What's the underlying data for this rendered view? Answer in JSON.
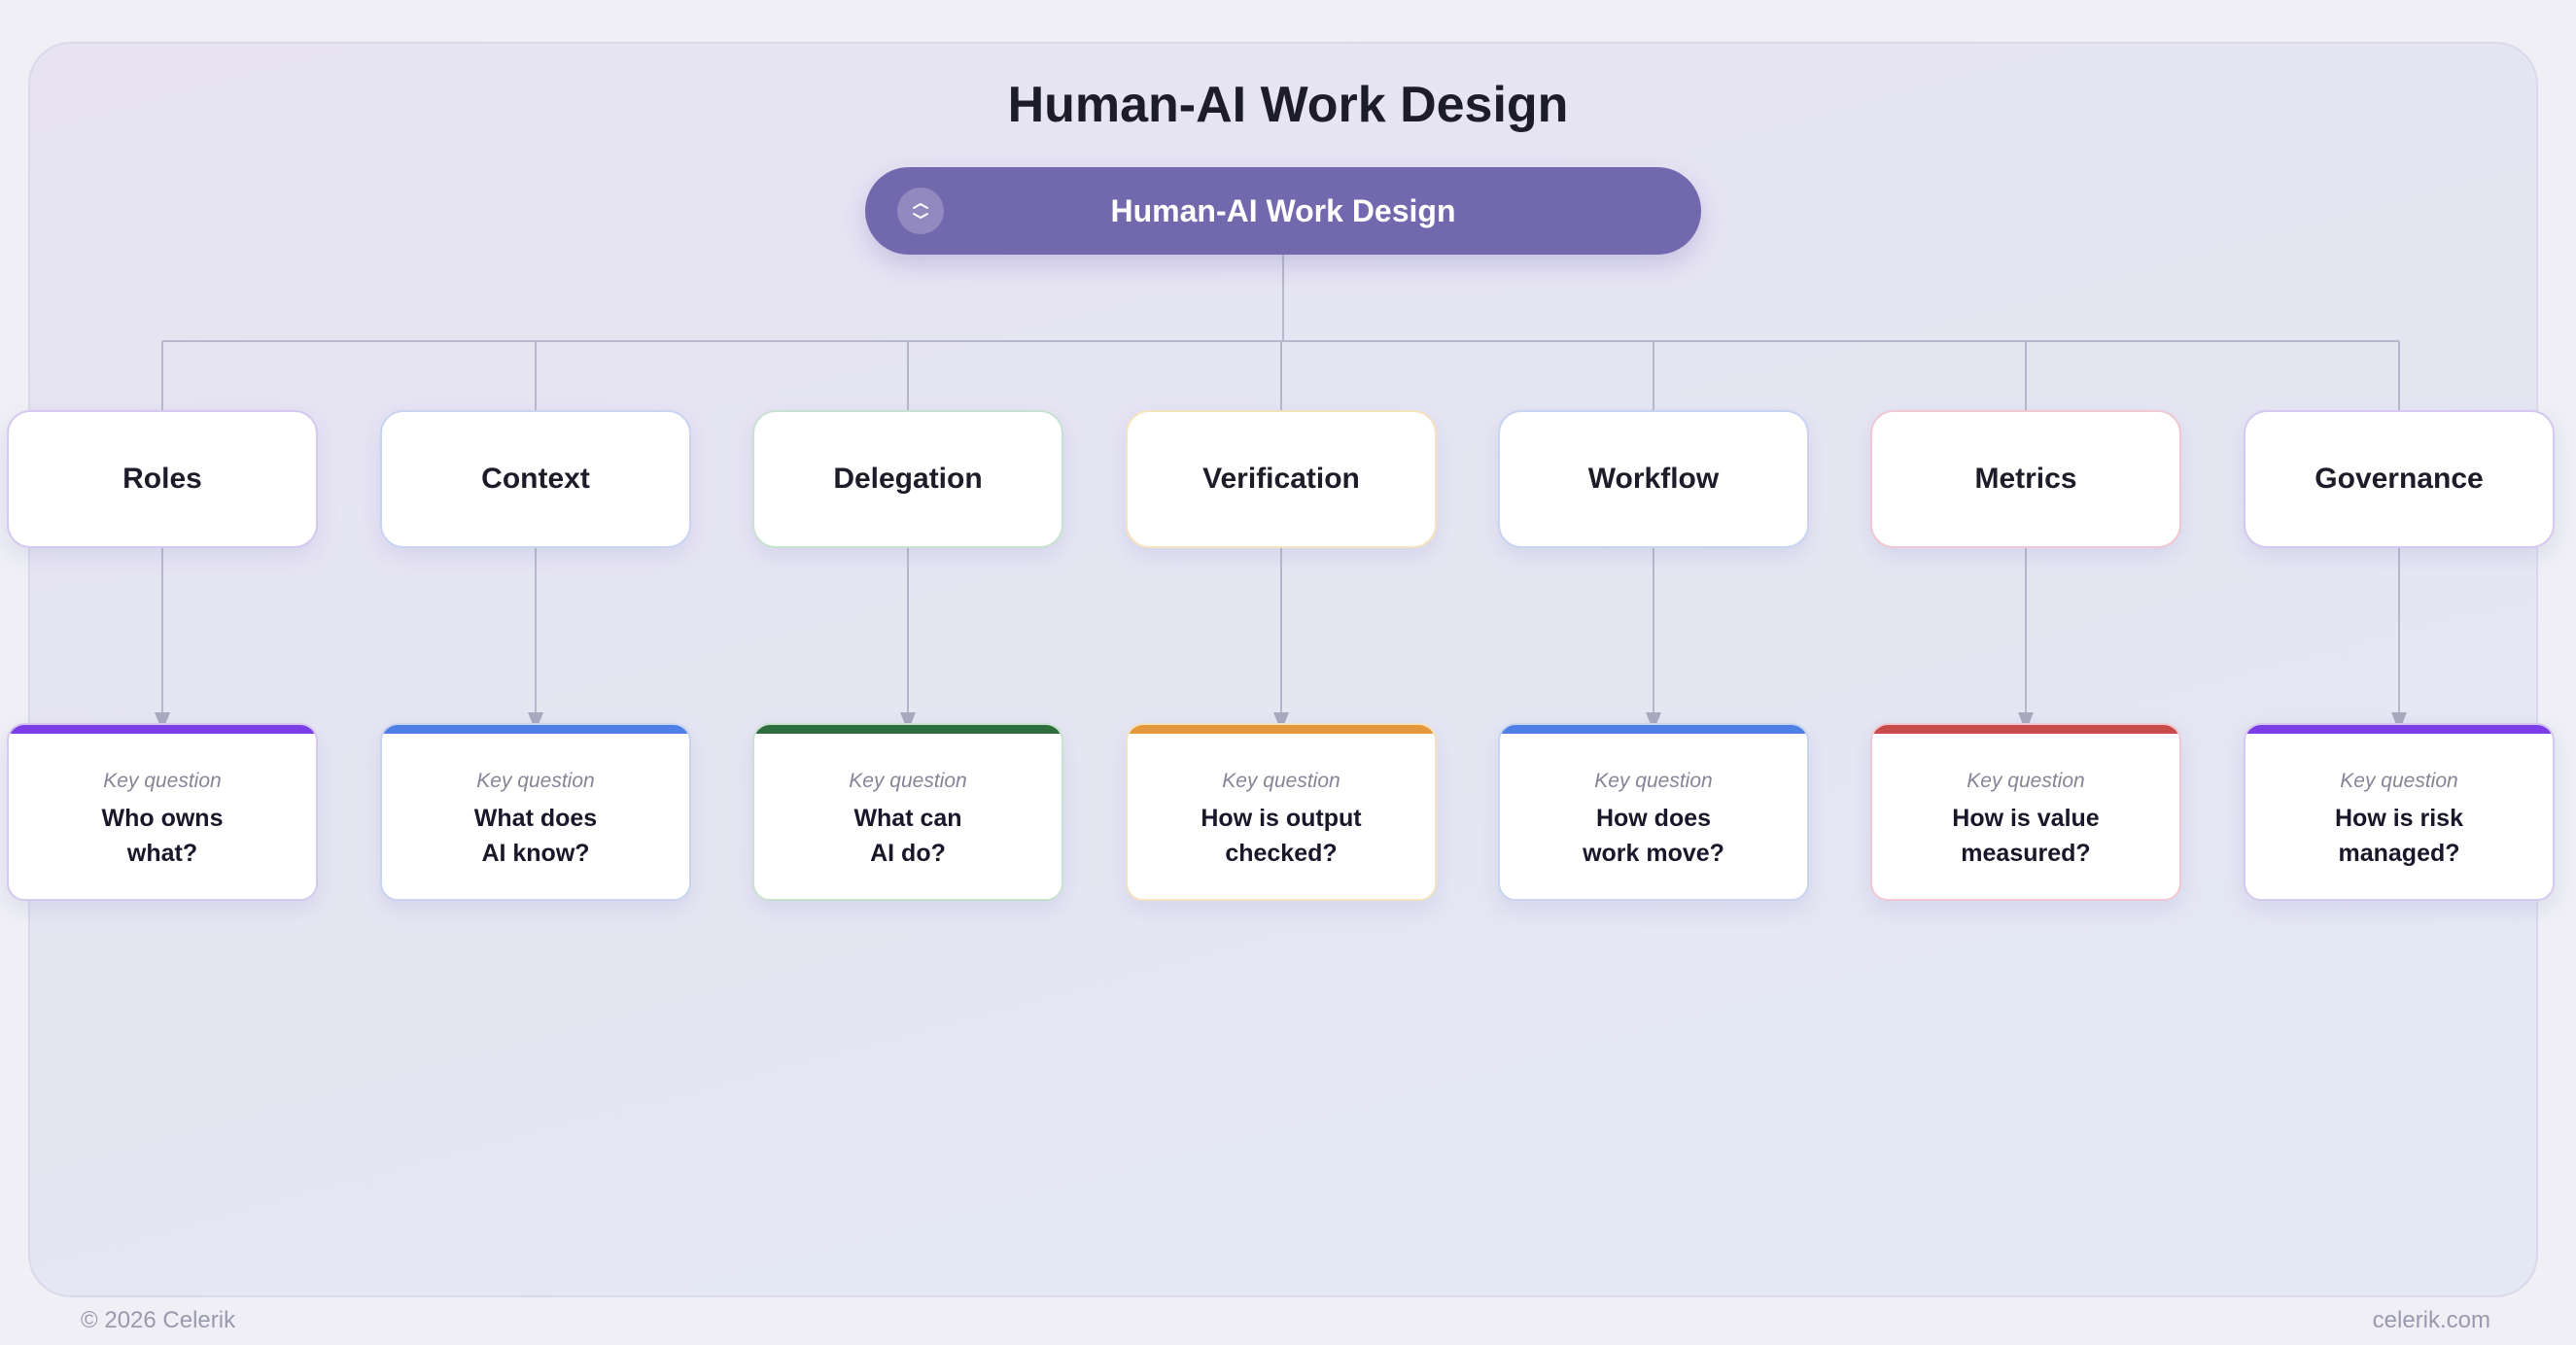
{
  "title": "Human-AI Work Design",
  "root": {
    "label": "Human-AI Work Design",
    "icon": "link-icon"
  },
  "kicker": "Key question",
  "branches": [
    {
      "label": "Roles",
      "accent": "#7b3ee6",
      "border": "#d6c8ee",
      "q1": "Who owns",
      "q2": "what?"
    },
    {
      "label": "Context",
      "accent": "#4e7fe6",
      "border": "#c8d4f0",
      "q1": "What does",
      "q2": "AI know?"
    },
    {
      "label": "Delegation",
      "accent": "#2e6e3e",
      "border": "#c9e2cf",
      "q1": "What can",
      "q2": "AI do?"
    },
    {
      "label": "Verification",
      "accent": "#e49a3c",
      "border": "#f5e2bf",
      "q1": "How is output",
      "q2": "checked?"
    },
    {
      "label": "Workflow",
      "accent": "#4e7fe6",
      "border": "#c8d4f0",
      "q1": "How does",
      "q2": "work move?"
    },
    {
      "label": "Metrics",
      "accent": "#c94b4b",
      "border": "#f1c8d2",
      "q1": "How is value",
      "q2": "measured?"
    },
    {
      "label": "Governance",
      "accent": "#7b3ee6",
      "border": "#d6c8ee",
      "q1": "How is risk",
      "q2": "managed?"
    }
  ],
  "footer": {
    "left": "© 2026 Celerik",
    "right": "celerik.com"
  }
}
